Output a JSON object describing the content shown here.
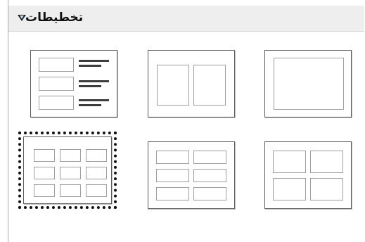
{
  "panel": {
    "title": "تخطيطات",
    "collapse_icon": "triangle-down-icon"
  },
  "layouts": [
    {
      "id": "title-content",
      "selected": false
    },
    {
      "id": "two-content",
      "selected": false
    },
    {
      "id": "blank-content",
      "selected": false
    },
    {
      "id": "three-by-three",
      "selected": true
    },
    {
      "id": "two-by-three",
      "selected": false
    },
    {
      "id": "two-by-two",
      "selected": false
    }
  ],
  "colors": {
    "header_bg": "#eeeeee",
    "border": "#5a5a5a",
    "placeholder_border": "#9e9e9e",
    "selection": "#111111"
  }
}
